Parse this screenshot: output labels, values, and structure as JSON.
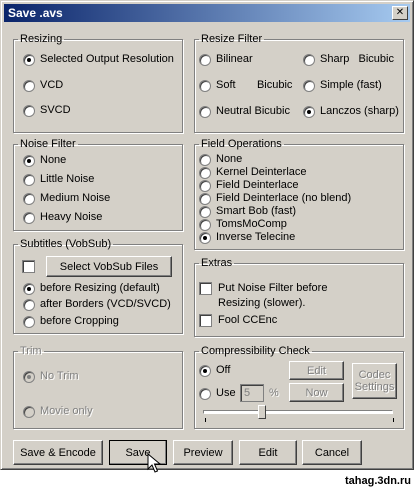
{
  "window": {
    "title": "Save .avs"
  },
  "resizing": {
    "legend": "Resizing",
    "options": [
      "Selected Output Resolution",
      "VCD",
      "SVCD"
    ],
    "selected": 0
  },
  "resize_filter": {
    "legend": "Resize Filter",
    "options": [
      "Bilinear",
      "Sharp   Bicubic",
      "Soft       Bicubic",
      "Simple (fast)",
      "Neutral Bicubic",
      "Lanczos (sharp)"
    ],
    "selected": 5
  },
  "noise_filter": {
    "legend": "Noise Filter",
    "options": [
      "None",
      "Little Noise",
      "Medium Noise",
      "Heavy Noise"
    ],
    "selected": 0
  },
  "field_operations": {
    "legend": "Field Operations",
    "options": [
      "None",
      "Kernel Deinterlace",
      "Field Deinterlace",
      "Field Deinterlace (no blend)",
      "Smart Bob (fast)",
      "TomsMoComp",
      "Inverse Telecine"
    ],
    "selected": 6
  },
  "subtitles": {
    "legend": "Subtitles (VobSub)",
    "select_button": "Select VobSub Files",
    "checked": false,
    "options": [
      "before Resizing (default)",
      "after Borders (VCD/SVCD)",
      "before Cropping"
    ],
    "selected": 0
  },
  "extras": {
    "legend": "Extras",
    "put_noise_line1": "Put Noise Filter before",
    "put_noise_line2": "Resizing (slower).",
    "fool_ccenc": "Fool CCEnc"
  },
  "trim": {
    "legend": "Trim",
    "options": [
      "No Trim",
      "Movie only"
    ],
    "selected": 0
  },
  "compressibility": {
    "legend": "Compressibility Check",
    "off": "Off",
    "use": "Use",
    "use_value": "5",
    "percent": "%",
    "edit": "Edit",
    "now": "Now",
    "codec_line1": "Codec",
    "codec_line2": "Settings",
    "selected": "off",
    "slider_level": 0.3
  },
  "buttons": {
    "save_encode": "Save & Encode",
    "save": "Save",
    "preview": "Preview",
    "edit": "Edit",
    "cancel": "Cancel"
  },
  "watermark": "tahag.3dn.ru",
  "icons": {
    "close": "close-icon",
    "cursor": "pointer-hand-icon"
  }
}
